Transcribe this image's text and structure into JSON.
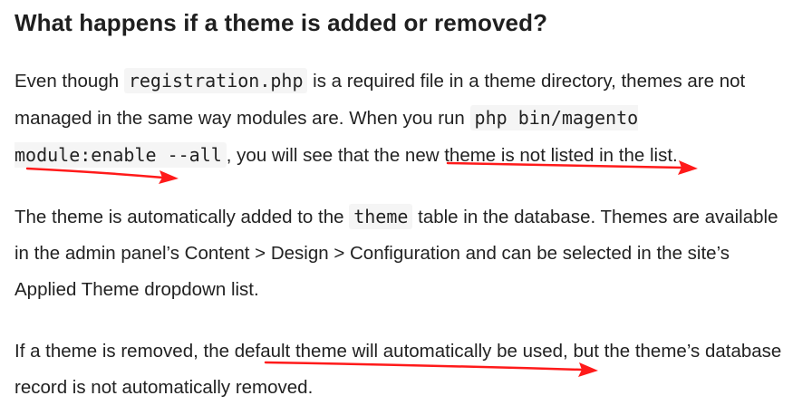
{
  "heading": "What happens if a theme is added or removed?",
  "paragraph1": {
    "text_before_code1": "Even though ",
    "code1": "registration.php",
    "text_after_code1": " is a required file in a theme directory, themes are not managed in the same way modules are. When you run ",
    "code2": "php bin/magento module:enable --all",
    "text_after_code2": ", you will see that the new theme is not listed in the list."
  },
  "paragraph2": {
    "text_before_code": "The theme is automatically added to the ",
    "code": "theme",
    "text_after_code": " table in the database. Themes are available in the admin panel’s Content > Design > Configuration and can be selected in the site’s Applied Theme dropdown list."
  },
  "paragraph3": {
    "text": "If a theme is removed, the default theme will automatically be used, but the theme’s database record is not automatically removed."
  },
  "annotation_color": "#ff1a1a"
}
